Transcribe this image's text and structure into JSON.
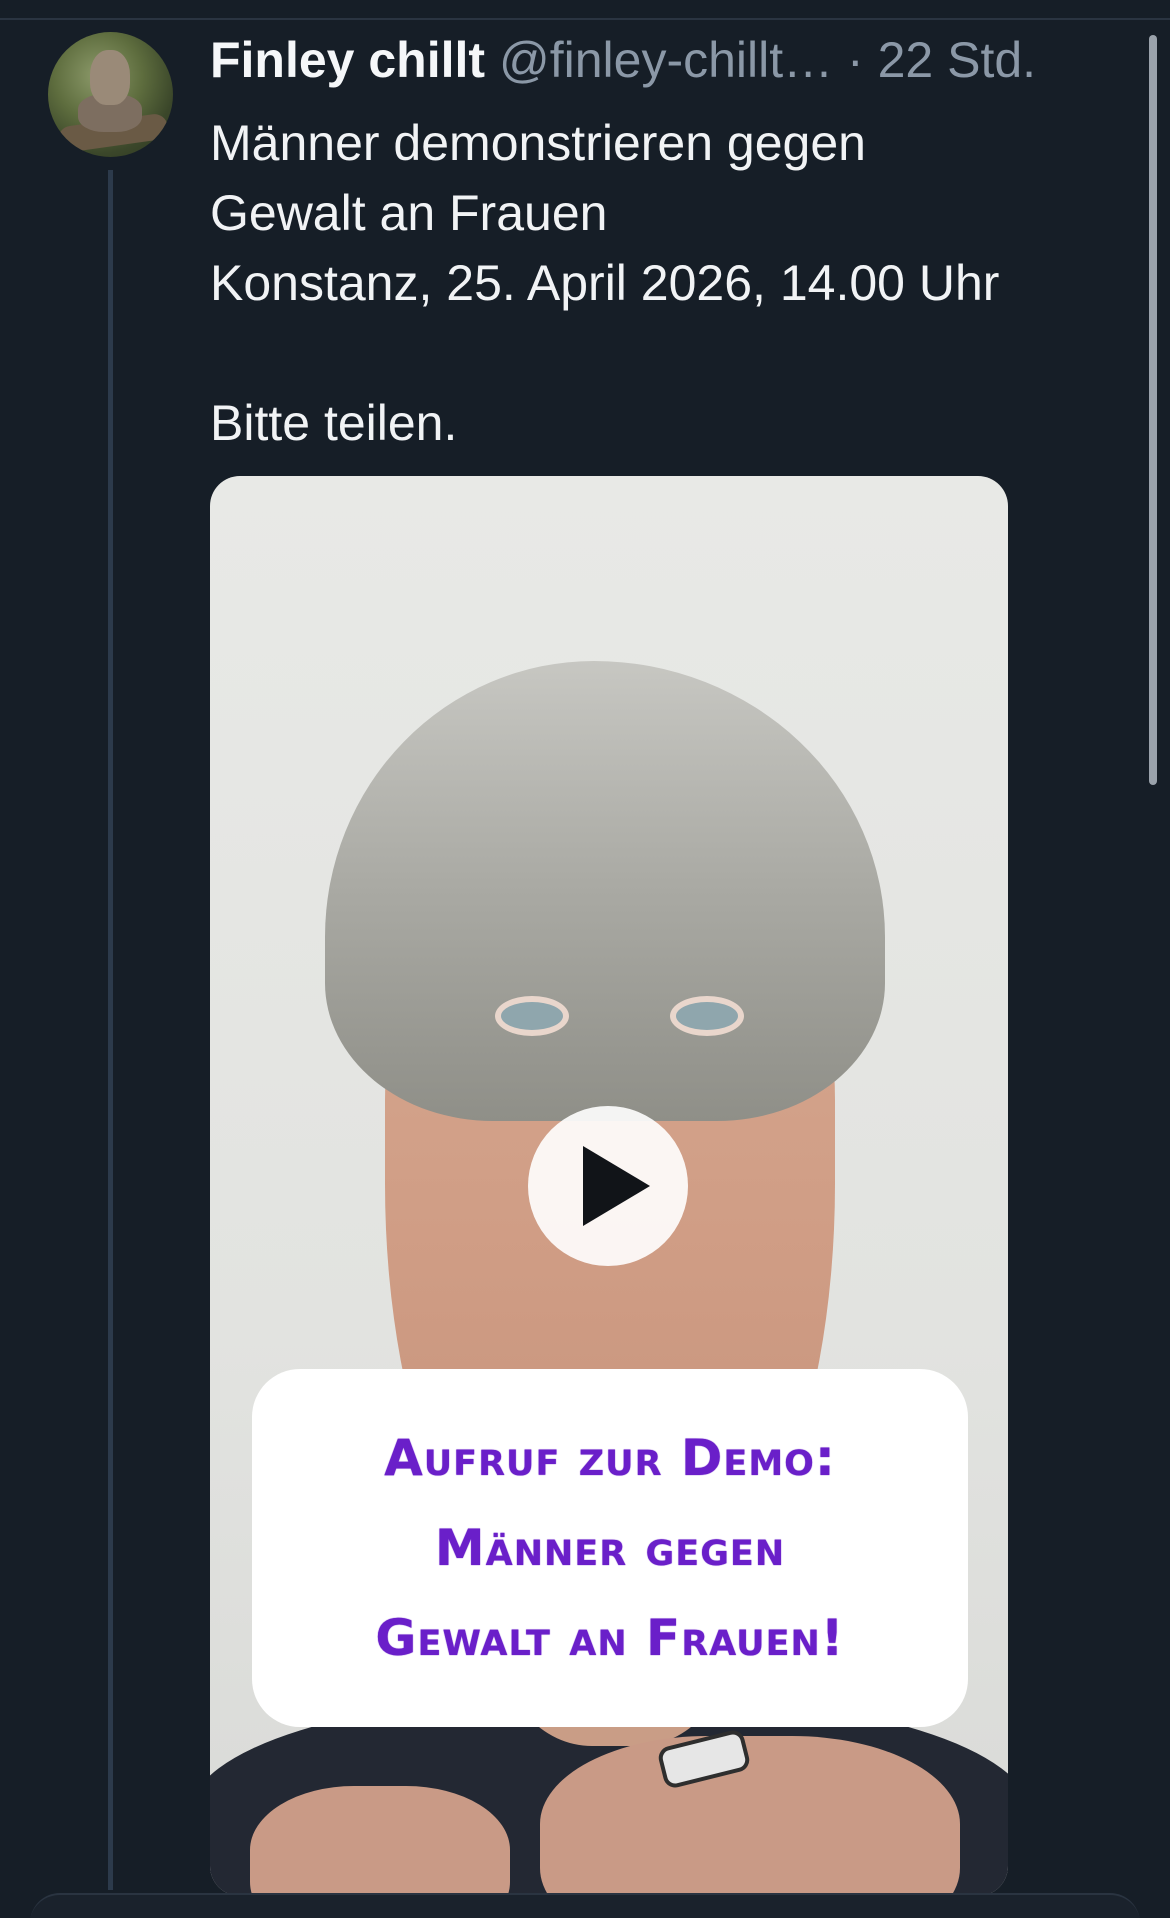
{
  "post": {
    "author_name": "Finley chillt",
    "author_handle": "@finley-chillt…",
    "separator": "·",
    "time": "22 Std.",
    "text_lines": [
      "Männer demonstrieren gegen",
      "Gewalt an Frauen",
      "Konstanz, 25. April 2026, 14.00 Uhr"
    ],
    "text_footer": "Bitte teilen."
  },
  "video": {
    "sign_lines": [
      "Aufruf zur Demo:",
      "Männer gegen",
      "Gewalt an Frauen!"
    ],
    "play_icon": "play-icon"
  },
  "colors": {
    "background": "#161e27",
    "sign_text": "#6a1fc9",
    "muted_text": "#8b98a7",
    "thread_line": "#2c3a4b"
  }
}
